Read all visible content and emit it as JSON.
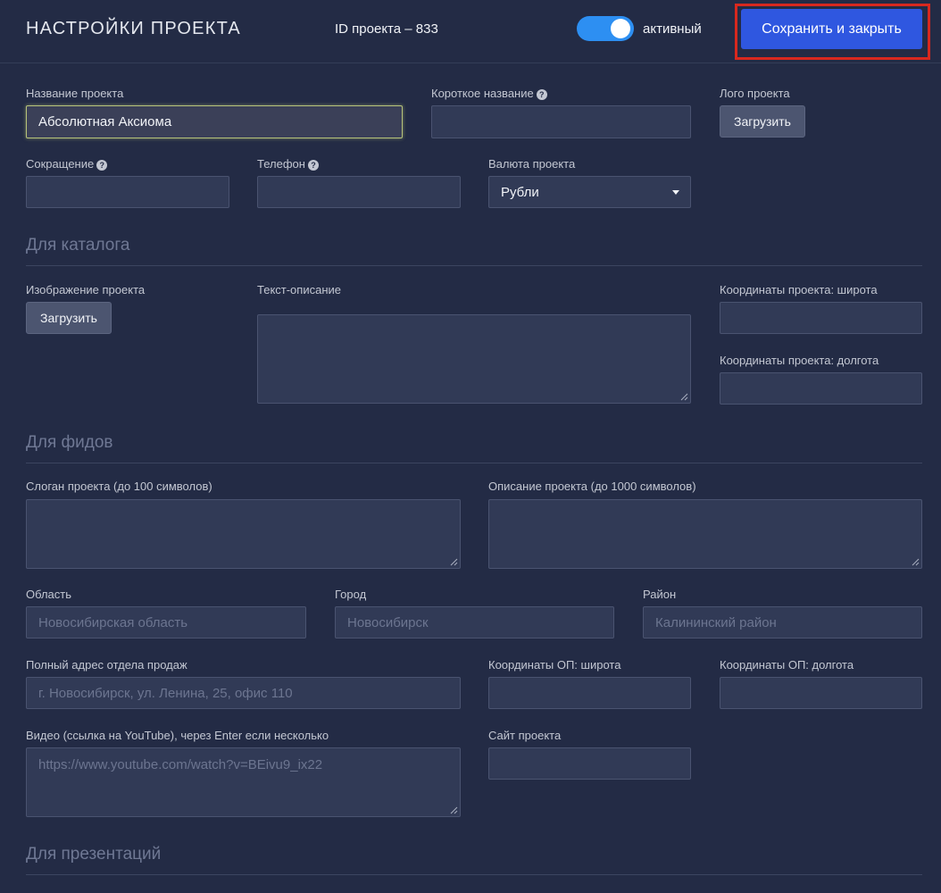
{
  "header": {
    "title": "НАСТРОЙКИ ПРОЕКТА",
    "project_id": "ID проекта – 833",
    "toggle_label": "активный",
    "toggle_on": true,
    "save_label": "Сохранить и закрыть",
    "accent_color": "#2f57e0"
  },
  "main": {
    "name_label": "Название проекта",
    "name_value": "Абсолютная Аксиома",
    "short_name_label": "Короткое название",
    "logo_label": "Лого проекта",
    "upload_label": "Загрузить",
    "abbr_label": "Сокращение",
    "phone_label": "Телефон",
    "currency_label": "Валюта проекта",
    "currency_value": "Рубли"
  },
  "catalog": {
    "section_title": "Для каталога",
    "image_label": "Изображение проекта",
    "upload_label": "Загрузить",
    "description_label": "Текст-описание",
    "lat_label": "Координаты проекта: широта",
    "lng_label": "Координаты проекта: долгота"
  },
  "feeds": {
    "section_title": "Для фидов",
    "slogan_label": "Слоган проекта (до 100 символов)",
    "description_label": "Описание проекта (до 1000 символов)",
    "region_label": "Область",
    "region_placeholder": "Новосибирская область",
    "city_label": "Город",
    "city_placeholder": "Новосибирск",
    "district_label": "Район",
    "district_placeholder": "Калининский район",
    "address_label": "Полный адрес отдела продаж",
    "address_placeholder": "г. Новосибирск, ул. Ленина, 25, офис 110",
    "op_lat_label": "Координаты ОП: широта",
    "op_lng_label": "Координаты ОП: долгота",
    "video_label": "Видео (ссылка на YouTube), через Enter если несколько",
    "video_placeholder": "https://www.youtube.com/watch?v=BEivu9_ix22",
    "site_label": "Сайт проекта"
  },
  "presentations": {
    "section_title": "Для презентаций"
  }
}
